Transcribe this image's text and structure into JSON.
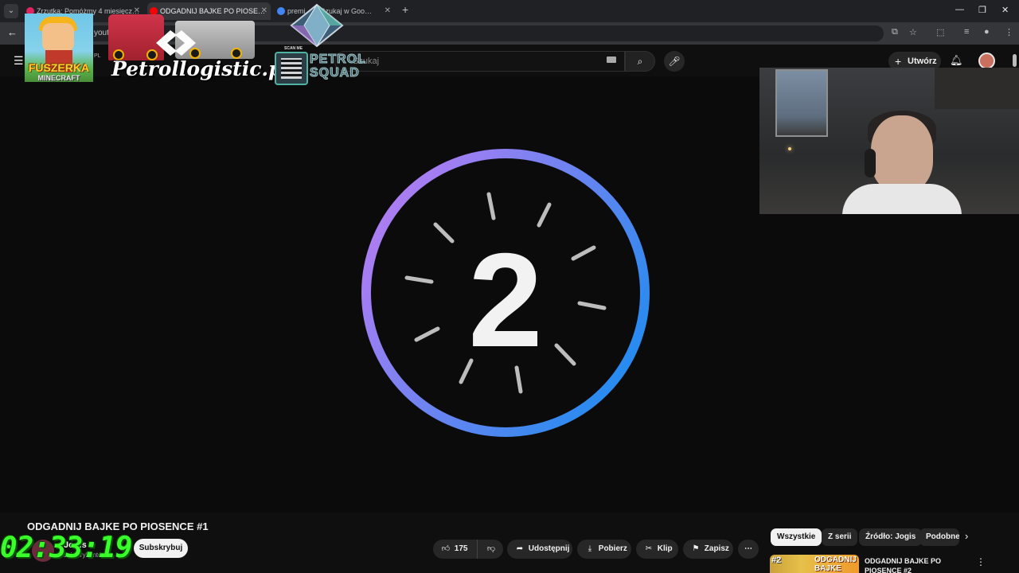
{
  "browser": {
    "tabs": [
      {
        "label": "Zrzutka: Pomóżmy 4 miesięcz…",
        "favicon_color": "#e0245e"
      },
      {
        "label": "ODGADNIJ BAJKE PO PIOSE…",
        "favicon_color": "#ff0000",
        "active": true
      },
      {
        "label": "premi… – Szukaj w Goo…",
        "favicon_color": "#4285f4"
      }
    ],
    "new_tab": "+",
    "url": "youtub…"
  },
  "youtube_header": {
    "country_code": "PL",
    "search_placeholder": "Szukaj",
    "create_label": "Utwórz"
  },
  "overlays": {
    "fuszerka_title": "FUSZERKA",
    "fuszerka_subtitle": "MINECRAFT",
    "petrol_logo_text": "Petrollogistic.pl",
    "scan_me": "SCAN ME",
    "petrol_squad_line1": "PETROL",
    "petrol_squad_line2": "SQUAD",
    "timer": "02:33:19"
  },
  "video": {
    "countdown_number": "2",
    "ring_color_start": "#b57cf2",
    "ring_color_end": "#1e8cf0",
    "title": "ODGADNIJ BAJKE PO PIOSENCE #1"
  },
  "channel": {
    "name": "Jogis",
    "subs": "subskrybentów",
    "subscribe_label": "Subskrybuj"
  },
  "actions": {
    "like_count": "175",
    "share_label": "Udostępnij",
    "download_label": "Pobierz",
    "clip_label": "Klip",
    "save_label": "Zapisz",
    "more": "⋯"
  },
  "chips": [
    "Wszystkie",
    "Z serii",
    "Źródło: Jogis",
    "Podobne"
  ],
  "recommendation": {
    "badge": "#2",
    "thumb_text": "ODGADNIJ BAJKE",
    "title": "ODGADNIJ BAJKE PO PIOSENCE #2"
  }
}
